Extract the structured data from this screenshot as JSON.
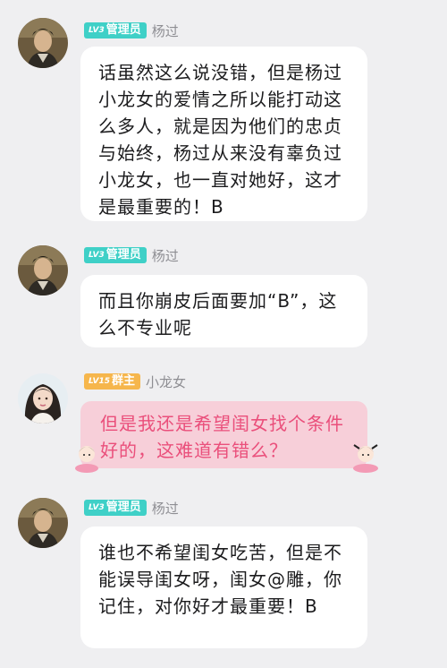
{
  "messages": [
    {
      "sender": "杨过",
      "level_label": "LV3",
      "role": "管理员",
      "avatar_icon": "warrior-avatar-icon",
      "text": "话虽然这么说没错，但是杨过小龙女的爱情之所以能打动这么多人，就是因为他们的忠贞与始终，杨过从来没有辜负过小龙女，也一直对她好，这才是最重要的！B"
    },
    {
      "sender": "杨过",
      "level_label": "LV3",
      "role": "管理员",
      "avatar_icon": "warrior-avatar-icon",
      "text": "而且你崩皮后面要加“B”，这么不专业呢"
    },
    {
      "sender": "小龙女",
      "level_label": "LV15",
      "role": "群主",
      "avatar_icon": "lady-avatar-icon",
      "text": "但是我还是希望闺女找个条件好的，这难道有错么？"
    },
    {
      "sender": "杨过",
      "level_label": "LV3",
      "role": "管理员",
      "avatar_icon": "warrior-avatar-icon",
      "text": "谁也不希望闺女吃苦，但是不能误导闺女呀，闺女@雕，你记住，对你好才最重要！B"
    }
  ],
  "colors": {
    "background": "#efeff1",
    "admin_badge": "#3fd0c7",
    "owner_badge": "#f6b64c",
    "pink_bubble": "#f7cfd9",
    "pink_text": "#ea4f7b"
  }
}
